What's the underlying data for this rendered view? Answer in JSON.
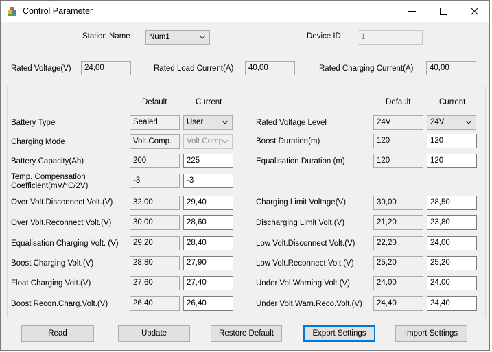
{
  "window": {
    "title": "Control Parameter",
    "minimize_glyph": "—",
    "maximize_glyph": "☐",
    "close_glyph": "✕"
  },
  "top": {
    "station_label": "Station Name",
    "station_value": "Num1",
    "device_id_label": "Device ID",
    "device_id_value": "1",
    "rated_voltage_label": "Rated Voltage(V)",
    "rated_voltage_value": "24,00",
    "rated_load_current_label": "Rated Load Current(A)",
    "rated_load_current_value": "40,00",
    "rated_charging_current_label": "Rated Charging Current(A)",
    "rated_charging_current_value": "40,00"
  },
  "headers": {
    "default": "Default",
    "current": "Current"
  },
  "left": [
    {
      "label": "Battery Type",
      "default": "Sealed",
      "current": "User"
    },
    {
      "label": "Charging Mode",
      "default": "Volt.Comp.",
      "current": "Volt.Comp"
    },
    {
      "label": "Battery Capacity(Ah)",
      "default": "200",
      "current": "225"
    },
    {
      "label": "Temp. Compensation",
      "label2": "Coefficient(mV/°C/2V)",
      "default": "-3",
      "current": "-3"
    },
    {
      "label": "Over Volt.Disconnect Volt.(V)",
      "default": "32,00",
      "current": "29,40"
    },
    {
      "label": "Over Volt.Reconnect Volt.(V)",
      "default": "30,00",
      "current": "28,60"
    },
    {
      "label": "Equalisation Charging Volt. (V)",
      "default": "29,20",
      "current": "28,40"
    },
    {
      "label": "Boost Charging Volt.(V)",
      "default": "28,80",
      "current": "27,90"
    },
    {
      "label": "Float Charging Volt.(V)",
      "default": "27,60",
      "current": "27,40"
    },
    {
      "label": "Boost Recon.Charg.Volt.(V)",
      "default": "26,40",
      "current": "26,40"
    }
  ],
  "right": [
    {
      "label": "Rated Voltage Level",
      "default": "24V",
      "current": "24V"
    },
    {
      "label": "Boost Duration(m)",
      "default": "120",
      "current": "120"
    },
    {
      "label": "Equalisation Duration (m)",
      "default": "120",
      "current": "120"
    },
    {
      "label": "Charging Limit Voltage(V)",
      "default": "30,00",
      "current": "28,50"
    },
    {
      "label": "Discharging Limit Volt.(V)",
      "default": "21,20",
      "current": "23,80"
    },
    {
      "label": "Low Volt.Disconnect Volt.(V)",
      "default": "22,20",
      "current": "24,00"
    },
    {
      "label": "Low Volt.Reconnect Volt.(V)",
      "default": "25,20",
      "current": "25,20"
    },
    {
      "label": "Under Vol.Warning Volt.(V)",
      "default": "24,00",
      "current": "24,00"
    },
    {
      "label": "Under Volt.Warn.Reco.Volt.(V)",
      "default": "24,40",
      "current": "24,40"
    }
  ],
  "buttons": {
    "read": "Read",
    "update": "Update",
    "restore_default": "Restore Default",
    "export_settings": "Export Settings",
    "import_settings": "Import Settings"
  },
  "colors": {
    "focus": "#0078d7",
    "window_bg": "#f0f0f0"
  }
}
